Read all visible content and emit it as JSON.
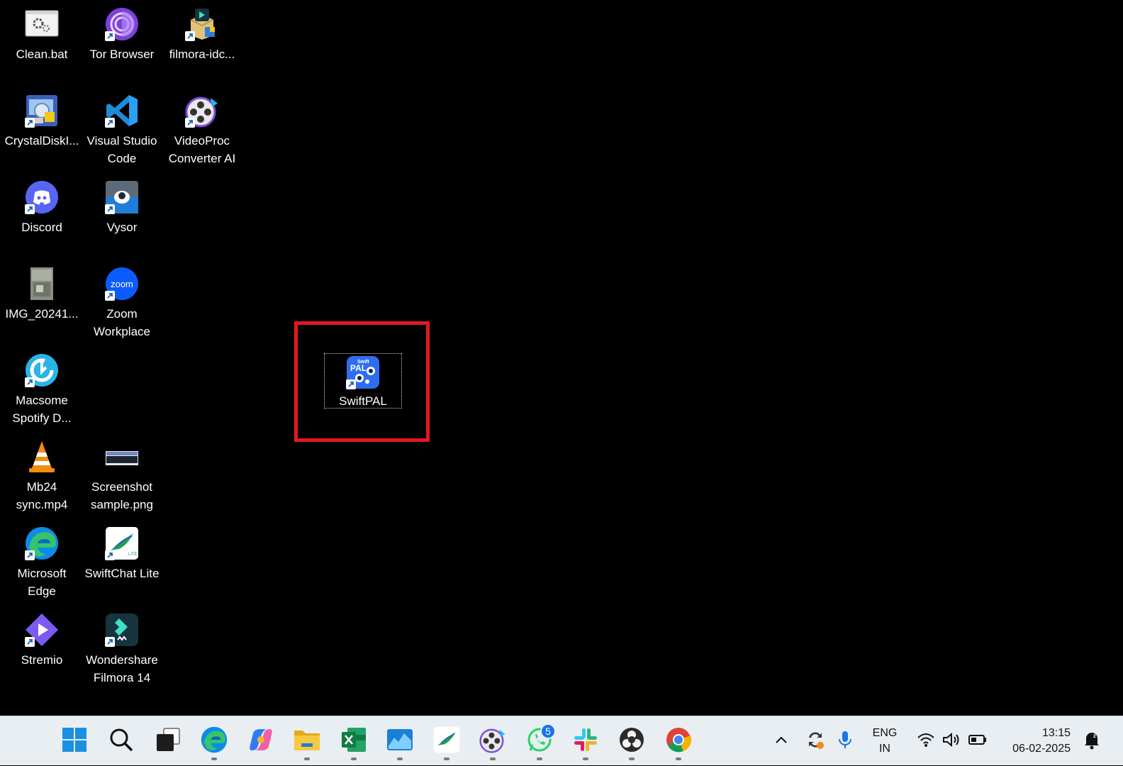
{
  "desktop": {
    "icons": [
      {
        "label": "Clean.bat",
        "icon": "batch-file-icon"
      },
      {
        "label": "Tor Browser",
        "icon": "tor-browser-icon"
      },
      {
        "label": "filmora-idc...",
        "icon": "installer-package-icon"
      },
      {
        "label": "CrystalDiskI...",
        "icon": "crystaldiskinfo-icon"
      },
      {
        "label": "Visual Studio Code",
        "icon": "vscode-icon"
      },
      {
        "label": "VideoProc Converter AI",
        "icon": "videoproc-icon"
      },
      {
        "label": "Discord",
        "icon": "discord-icon"
      },
      {
        "label": "Vysor",
        "icon": "vysor-icon"
      },
      {
        "label": "IMG_20241...",
        "icon": "image-thumbnail-icon"
      },
      {
        "label": "Zoom Workplace",
        "icon": "zoom-icon"
      },
      {
        "label": "Macsome Spotify D...",
        "icon": "macsome-icon"
      },
      {
        "label": "Mb24 sync.mp4",
        "icon": "vlc-icon"
      },
      {
        "label": "Screenshot sample.png",
        "icon": "screenshot-thumbnail-icon"
      },
      {
        "label": "Microsoft Edge",
        "icon": "edge-icon"
      },
      {
        "label": "SwiftChat Lite",
        "icon": "swiftchat-icon"
      },
      {
        "label": "Stremio",
        "icon": "stremio-icon"
      },
      {
        "label": "Wondershare Filmora 14",
        "icon": "filmora-icon"
      }
    ],
    "selected_icon": {
      "label": "SwiftPAL",
      "icon": "swiftpal-icon",
      "icon_text": "Swift PAL"
    },
    "zoom_icon_text": "zoom",
    "highlight_color": "#e0191f"
  },
  "taskbar": {
    "apps": [
      {
        "name": "Start",
        "icon": "windows-start-icon"
      },
      {
        "name": "Search",
        "icon": "search-icon"
      },
      {
        "name": "Task View",
        "icon": "task-view-icon"
      },
      {
        "name": "Microsoft Edge",
        "icon": "edge-icon"
      },
      {
        "name": "Copilot",
        "icon": "copilot-icon"
      },
      {
        "name": "File Explorer",
        "icon": "folder-icon"
      },
      {
        "name": "Excel",
        "icon": "excel-icon"
      },
      {
        "name": "Stock monitor",
        "icon": "chart-app-icon"
      },
      {
        "name": "SwiftChat Lite",
        "icon": "swiftchat-icon"
      },
      {
        "name": "VideoProc",
        "icon": "videoproc-icon"
      },
      {
        "name": "WhatsApp",
        "icon": "whatsapp-icon",
        "badge": "5"
      },
      {
        "name": "Slack",
        "icon": "slack-icon"
      },
      {
        "name": "OBS Studio",
        "icon": "obs-icon"
      },
      {
        "name": "Google Chrome",
        "icon": "chrome-icon"
      }
    ],
    "tray": {
      "language_line1": "ENG",
      "language_line2": "IN",
      "time": "13:15",
      "date": "06-02-2025"
    }
  }
}
